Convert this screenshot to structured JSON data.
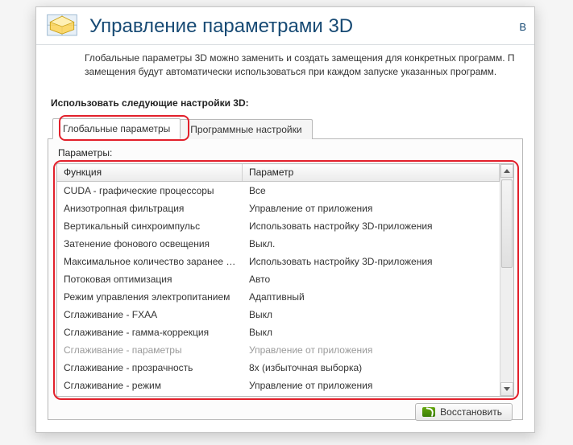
{
  "header": {
    "title": "Управление параметрами 3D",
    "right_cutoff": "В"
  },
  "intro": {
    "line1": "Глобальные параметры 3D можно заменить и создать замещения для конкретных программ. П",
    "line2": "замещения будут автоматически использоваться при каждом запуске указанных программ."
  },
  "section_title": "Использовать следующие настройки 3D:",
  "tabs": {
    "global_label": "Глобальные параметры",
    "program_label": "Программные настройки"
  },
  "param_label": "Параметры:",
  "columns": {
    "func": "Функция",
    "param": "Параметр"
  },
  "rows": [
    {
      "func": "CUDA - графические процессоры",
      "param": "Все",
      "disabled": false
    },
    {
      "func": "Анизотропная фильтрация",
      "param": "Управление от приложения",
      "disabled": false
    },
    {
      "func": "Вертикальный синхроимпульс",
      "param": "Использовать настройку 3D-приложения",
      "disabled": false
    },
    {
      "func": "Затенение фонового освещения",
      "param": "Выкл.",
      "disabled": false
    },
    {
      "func": "Максимальное количество заранее под...",
      "param": "Использовать настройку 3D-приложения",
      "disabled": false
    },
    {
      "func": "Потоковая оптимизация",
      "param": "Авто",
      "disabled": false
    },
    {
      "func": "Режим управления электропитанием",
      "param": "Адаптивный",
      "disabled": false
    },
    {
      "func": "Сглаживание - FXAA",
      "param": "Выкл",
      "disabled": false
    },
    {
      "func": "Сглаживание - гамма-коррекция",
      "param": "Выкл",
      "disabled": false
    },
    {
      "func": "Сглаживание - параметры",
      "param": "Управление от приложения",
      "disabled": true
    },
    {
      "func": "Сглаживание - прозрачность",
      "param": "8x (избыточная выборка)",
      "disabled": false
    },
    {
      "func": "Сглаживание - режим",
      "param": "Управление от приложения",
      "disabled": false
    }
  ],
  "restore_button": "Восстановить"
}
